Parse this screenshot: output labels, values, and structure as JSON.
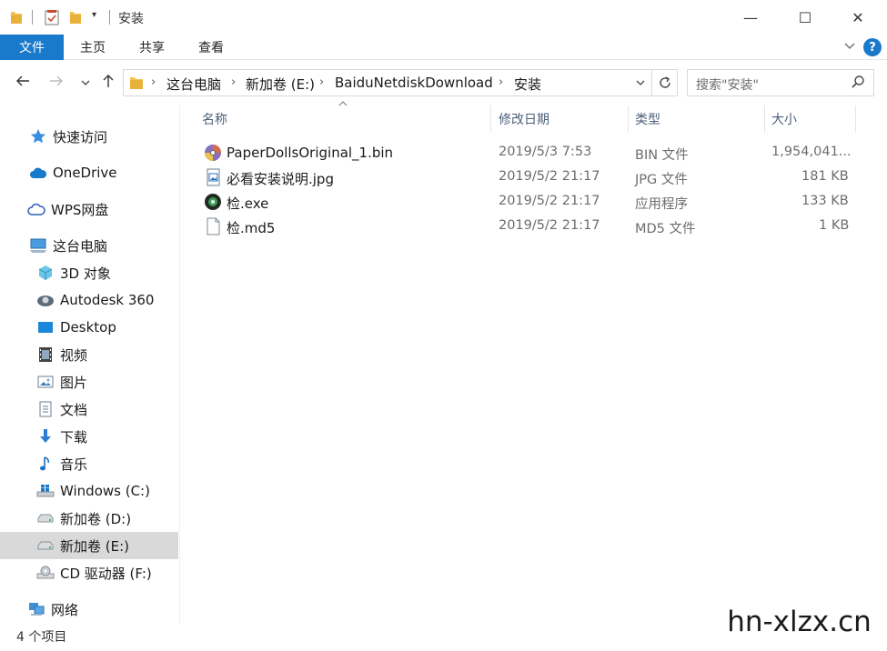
{
  "window": {
    "title": "安装",
    "minimize": "—",
    "maximize": "☐",
    "close": "✕"
  },
  "ribbon": {
    "tabs": [
      "文件",
      "主页",
      "共享",
      "查看"
    ],
    "expand_icon": "chevron-down-icon",
    "help": "?"
  },
  "address": {
    "breadcrumbs": [
      "这台电脑",
      "新加卷 (E:)",
      "BaiduNetdiskDownload",
      "安装"
    ],
    "search_placeholder": "搜索\"安装\""
  },
  "sidebar": {
    "items": [
      {
        "label": "快速访问",
        "icon": "star-icon"
      },
      {
        "label": "OneDrive",
        "icon": "cloud-icon"
      },
      {
        "label": "WPS网盘",
        "icon": "cloud-outline-icon"
      },
      {
        "label": "这台电脑",
        "icon": "computer-icon"
      },
      {
        "label": "3D 对象",
        "icon": "cube-icon"
      },
      {
        "label": "Autodesk 360",
        "icon": "autodesk-icon"
      },
      {
        "label": "Desktop",
        "icon": "desktop-icon"
      },
      {
        "label": "视频",
        "icon": "video-icon"
      },
      {
        "label": "图片",
        "icon": "picture-icon"
      },
      {
        "label": "文档",
        "icon": "document-icon"
      },
      {
        "label": "下载",
        "icon": "download-icon"
      },
      {
        "label": "音乐",
        "icon": "music-icon"
      },
      {
        "label": "Windows (C:)",
        "icon": "windows-drive-icon"
      },
      {
        "label": "新加卷 (D:)",
        "icon": "drive-icon"
      },
      {
        "label": "新加卷 (E:)",
        "icon": "drive-icon",
        "selected": true
      },
      {
        "label": "CD 驱动器 (F:)",
        "icon": "cd-drive-icon"
      },
      {
        "label": "网络",
        "icon": "network-icon"
      }
    ]
  },
  "columns": [
    "名称",
    "修改日期",
    "类型",
    "大小"
  ],
  "files": [
    {
      "name": "PaperDollsOriginal_1.bin",
      "date": "2019/5/3 7:53",
      "type": "BIN 文件",
      "size": "1,954,041...",
      "icon": "disc-image-icon"
    },
    {
      "name": "必看安装说明.jpg",
      "date": "2019/5/2 21:17",
      "type": "JPG 文件",
      "size": "181 KB",
      "icon": "image-file-icon"
    },
    {
      "name": "检.exe",
      "date": "2019/5/2 21:17",
      "type": "应用程序",
      "size": "133 KB",
      "icon": "app-icon"
    },
    {
      "name": "检.md5",
      "date": "2019/5/2 21:17",
      "type": "MD5 文件",
      "size": "1 KB",
      "icon": "blank-file-icon"
    }
  ],
  "status": {
    "count": "4 个项目"
  },
  "watermark": "hn-xlzx.cn",
  "colors": {
    "accent": "#1979ca",
    "selected_bg": "#d9d9d9",
    "header_text": "#4c607a"
  }
}
